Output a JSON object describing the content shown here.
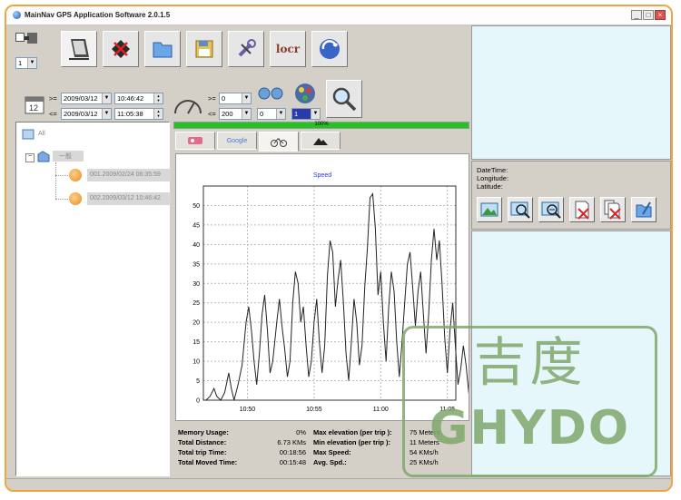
{
  "window": {
    "title": "MainNav GPS Application Software 2.0.1.5",
    "min_glyph": "_",
    "max_glyph": "□",
    "close_glyph": "×"
  },
  "toolbar": {
    "device_select": "1",
    "buttons": [
      {
        "name": "device-button",
        "icon": "device-icon"
      },
      {
        "name": "delete-button",
        "icon": "delete-icon"
      },
      {
        "name": "open-folder-button",
        "icon": "folder-icon"
      },
      {
        "name": "save-button",
        "icon": "floppy-icon"
      },
      {
        "name": "settings-button",
        "icon": "tools-icon"
      },
      {
        "name": "locr-button",
        "icon": "locr-icon",
        "text": "locr"
      },
      {
        "name": "internet-button",
        "icon": "globe-icon"
      }
    ]
  },
  "filters": {
    "date_from_op": ">=",
    "date_from": "2009/03/12",
    "time_from": "10:46:42",
    "date_to_op": "<=",
    "date_to": "2009/03/12",
    "time_to": "11:05:38",
    "speed_min_op": ">=",
    "speed_min": "0",
    "speed_max_op": "<=",
    "speed_max": "200",
    "points_value": "0",
    "color_value": "1"
  },
  "progress": {
    "percent_label": "100%",
    "value": 1.0
  },
  "tree": {
    "root_label": "All",
    "group_label": "一般",
    "items": [
      {
        "label": "001.2009/02/24 06:35:59"
      },
      {
        "label": "002.2009/03/12 10:46:42"
      }
    ]
  },
  "tabs": [
    {
      "name": "tab-map",
      "label": ""
    },
    {
      "name": "tab-google",
      "label": "Google"
    },
    {
      "name": "tab-speed",
      "label": ""
    },
    {
      "name": "tab-elevation",
      "label": ""
    }
  ],
  "chart_data": {
    "type": "line",
    "title": "Speed",
    "xlabel": "",
    "ylabel": "",
    "ylim": [
      0,
      55
    ],
    "yticks": [
      0,
      5,
      10,
      15,
      20,
      25,
      30,
      35,
      40,
      45,
      50
    ],
    "xticks": [
      "10:50",
      "10:55",
      "11:00",
      "11:05"
    ],
    "xlim": [
      "10:46:42",
      "11:05:38"
    ],
    "grid": true,
    "series": [
      {
        "values": [
          [
            0,
            0
          ],
          [
            0.2,
            0
          ],
          [
            0.5,
            1
          ],
          [
            0.8,
            3
          ],
          [
            1.0,
            1
          ],
          [
            1.3,
            0
          ],
          [
            1.6,
            2
          ],
          [
            1.9,
            7
          ],
          [
            2.1,
            3
          ],
          [
            2.3,
            0
          ],
          [
            2.6,
            4
          ],
          [
            2.9,
            9
          ],
          [
            3.2,
            20
          ],
          [
            3.4,
            24
          ],
          [
            3.6,
            18
          ],
          [
            3.8,
            10
          ],
          [
            4.0,
            4
          ],
          [
            4.2,
            12
          ],
          [
            4.4,
            22
          ],
          [
            4.6,
            27
          ],
          [
            4.8,
            18
          ],
          [
            5.0,
            7
          ],
          [
            5.2,
            10
          ],
          [
            5.5,
            20
          ],
          [
            5.7,
            26
          ],
          [
            5.9,
            19
          ],
          [
            6.1,
            13
          ],
          [
            6.3,
            6
          ],
          [
            6.5,
            10
          ],
          [
            6.7,
            25
          ],
          [
            6.9,
            33
          ],
          [
            7.1,
            30
          ],
          [
            7.3,
            20
          ],
          [
            7.5,
            24
          ],
          [
            7.7,
            14
          ],
          [
            7.9,
            6
          ],
          [
            8.1,
            10
          ],
          [
            8.3,
            20
          ],
          [
            8.5,
            26
          ],
          [
            8.7,
            15
          ],
          [
            8.9,
            7
          ],
          [
            9.1,
            14
          ],
          [
            9.3,
            32
          ],
          [
            9.5,
            41
          ],
          [
            9.7,
            38
          ],
          [
            9.9,
            24
          ],
          [
            10.1,
            31
          ],
          [
            10.3,
            36
          ],
          [
            10.5,
            25
          ],
          [
            10.7,
            12
          ],
          [
            10.9,
            5
          ],
          [
            11.1,
            15
          ],
          [
            11.3,
            26
          ],
          [
            11.5,
            20
          ],
          [
            11.7,
            9
          ],
          [
            11.9,
            14
          ],
          [
            12.1,
            29
          ],
          [
            12.3,
            39
          ],
          [
            12.5,
            52
          ],
          [
            12.7,
            53
          ],
          [
            12.9,
            44
          ],
          [
            13.1,
            27
          ],
          [
            13.3,
            33
          ],
          [
            13.5,
            20
          ],
          [
            13.7,
            10
          ],
          [
            13.9,
            24
          ],
          [
            14.1,
            33
          ],
          [
            14.3,
            28
          ],
          [
            14.5,
            15
          ],
          [
            14.7,
            6
          ],
          [
            14.9,
            15
          ],
          [
            15.1,
            25
          ],
          [
            15.3,
            35
          ],
          [
            15.5,
            38
          ],
          [
            15.7,
            29
          ],
          [
            15.9,
            19
          ],
          [
            16.1,
            28
          ],
          [
            16.3,
            33
          ],
          [
            16.5,
            22
          ],
          [
            16.7,
            12
          ],
          [
            16.9,
            22
          ],
          [
            17.1,
            36
          ],
          [
            17.3,
            44
          ],
          [
            17.5,
            36
          ],
          [
            17.7,
            41
          ],
          [
            17.9,
            30
          ],
          [
            18.1,
            16
          ],
          [
            18.3,
            7
          ],
          [
            18.5,
            18
          ],
          [
            18.7,
            25
          ],
          [
            18.9,
            14
          ],
          [
            19.1,
            4
          ],
          [
            19.3,
            8
          ],
          [
            19.5,
            14
          ],
          [
            19.7,
            9
          ],
          [
            19.9,
            2
          ],
          [
            20.0,
            0
          ]
        ]
      }
    ]
  },
  "stats": {
    "memory_usage_label": "Memory Usage:",
    "memory_usage": "0%",
    "total_distance_label": "Total Distance:",
    "total_distance": "6.73 KMs",
    "total_trip_time_label": "Total trip Time:",
    "total_trip_time": "00:18:56",
    "total_moved_time_label": "Total Moved Time:",
    "total_moved_time": "00:15:48",
    "max_elevation_label": "Max elevation (per trip ):",
    "max_elevation": "75 Meters",
    "min_elevation_label": "Min elevation (per trip ):",
    "min_elevation": "11 Meters",
    "max_speed_label": "Max Speed:",
    "max_speed": "54 KMs/h",
    "avg_speed_label": "Avg. Spd.:",
    "avg_speed": "25 KMs/h"
  },
  "info_panel": {
    "datetime_label": "DateTime:",
    "longitude_label": "Longitude:",
    "latitude_label": "Latitude:",
    "buttons": [
      {
        "name": "map-view-button",
        "icon": "landscape-icon"
      },
      {
        "name": "zoom-in-button",
        "icon": "zoom-in-icon"
      },
      {
        "name": "zoom-out-button",
        "icon": "zoom-out-icon"
      },
      {
        "name": "delete-point-button",
        "icon": "delete-point-icon"
      },
      {
        "name": "delete-points-button",
        "icon": "delete-points-icon"
      },
      {
        "name": "export-button",
        "icon": "export-icon"
      }
    ]
  },
  "watermark": {
    "cn_text": "吉度",
    "en_text": "GHYDO"
  },
  "colors": {
    "frame_border": "#f0a640",
    "progress_green": "#22c422",
    "panel_bg": "#d4d0c8",
    "right_panel_bg": "#e6f7fb",
    "watermark": "#7fa86b"
  }
}
